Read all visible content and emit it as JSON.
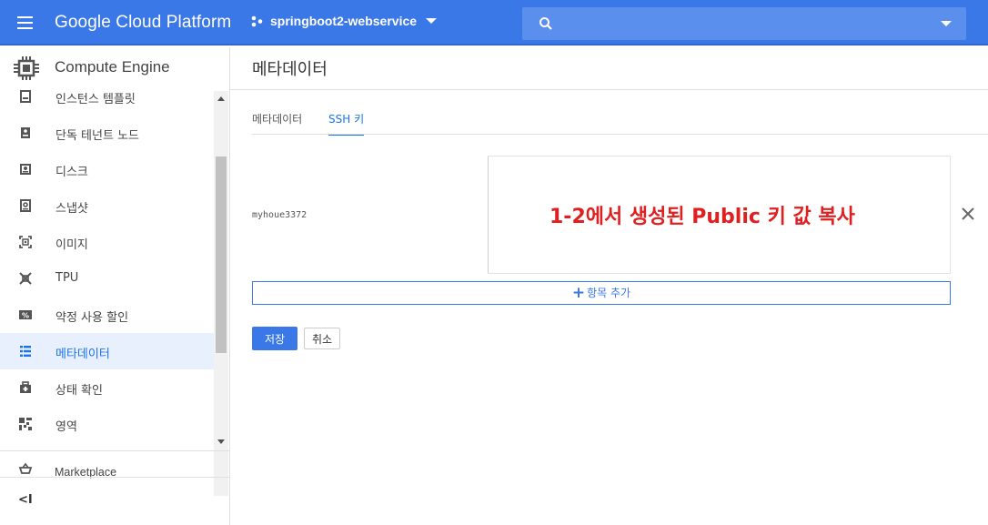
{
  "header": {
    "brand": "Google Cloud Platform",
    "project": "springboot2-webservice",
    "search_placeholder": "",
    "accent": "#3b78e7"
  },
  "sidebar": {
    "title": "Compute Engine",
    "items": [
      {
        "label": "인스턴스 템플릿",
        "icon": "instance-template-icon"
      },
      {
        "label": "단독 테넌트 노드",
        "icon": "sole-tenant-icon"
      },
      {
        "label": "디스크",
        "icon": "disk-icon"
      },
      {
        "label": "스냅샷",
        "icon": "snapshot-icon"
      },
      {
        "label": "이미지",
        "icon": "image-icon"
      },
      {
        "label": "TPU",
        "icon": "tpu-icon"
      },
      {
        "label": "약정 사용 할인",
        "icon": "discount-icon"
      },
      {
        "label": "메타데이터",
        "icon": "metadata-icon",
        "active": true
      },
      {
        "label": "상태 확인",
        "icon": "health-check-icon"
      },
      {
        "label": "영역",
        "icon": "zones-icon"
      }
    ],
    "marketplace": "Marketplace",
    "collapse": "<I"
  },
  "main": {
    "title": "메타데이터",
    "tabs": [
      "메타데이터",
      "SSH 키"
    ],
    "active_tab": "SSH 키",
    "ssh_key": {
      "username": "myhoue3372",
      "value": ""
    },
    "annotation": "1-2에서 생성된 Public 키 값 복사",
    "add_item": "항목 추가",
    "save": "저장",
    "cancel": "취소"
  }
}
